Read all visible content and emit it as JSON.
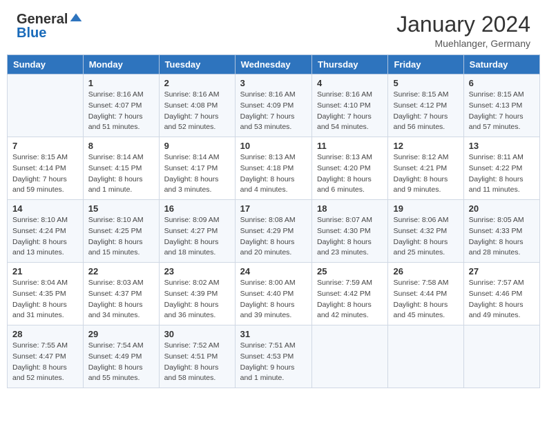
{
  "header": {
    "logo_general": "General",
    "logo_blue": "Blue",
    "month": "January 2024",
    "location": "Muehlanger, Germany"
  },
  "weekdays": [
    "Sunday",
    "Monday",
    "Tuesday",
    "Wednesday",
    "Thursday",
    "Friday",
    "Saturday"
  ],
  "weeks": [
    [
      {
        "day": "",
        "sunrise": "",
        "sunset": "",
        "daylight": ""
      },
      {
        "day": "1",
        "sunrise": "Sunrise: 8:16 AM",
        "sunset": "Sunset: 4:07 PM",
        "daylight": "Daylight: 7 hours and 51 minutes."
      },
      {
        "day": "2",
        "sunrise": "Sunrise: 8:16 AM",
        "sunset": "Sunset: 4:08 PM",
        "daylight": "Daylight: 7 hours and 52 minutes."
      },
      {
        "day": "3",
        "sunrise": "Sunrise: 8:16 AM",
        "sunset": "Sunset: 4:09 PM",
        "daylight": "Daylight: 7 hours and 53 minutes."
      },
      {
        "day": "4",
        "sunrise": "Sunrise: 8:16 AM",
        "sunset": "Sunset: 4:10 PM",
        "daylight": "Daylight: 7 hours and 54 minutes."
      },
      {
        "day": "5",
        "sunrise": "Sunrise: 8:15 AM",
        "sunset": "Sunset: 4:12 PM",
        "daylight": "Daylight: 7 hours and 56 minutes."
      },
      {
        "day": "6",
        "sunrise": "Sunrise: 8:15 AM",
        "sunset": "Sunset: 4:13 PM",
        "daylight": "Daylight: 7 hours and 57 minutes."
      }
    ],
    [
      {
        "day": "7",
        "sunrise": "Sunrise: 8:15 AM",
        "sunset": "Sunset: 4:14 PM",
        "daylight": "Daylight: 7 hours and 59 minutes."
      },
      {
        "day": "8",
        "sunrise": "Sunrise: 8:14 AM",
        "sunset": "Sunset: 4:15 PM",
        "daylight": "Daylight: 8 hours and 1 minute."
      },
      {
        "day": "9",
        "sunrise": "Sunrise: 8:14 AM",
        "sunset": "Sunset: 4:17 PM",
        "daylight": "Daylight: 8 hours and 3 minutes."
      },
      {
        "day": "10",
        "sunrise": "Sunrise: 8:13 AM",
        "sunset": "Sunset: 4:18 PM",
        "daylight": "Daylight: 8 hours and 4 minutes."
      },
      {
        "day": "11",
        "sunrise": "Sunrise: 8:13 AM",
        "sunset": "Sunset: 4:20 PM",
        "daylight": "Daylight: 8 hours and 6 minutes."
      },
      {
        "day": "12",
        "sunrise": "Sunrise: 8:12 AM",
        "sunset": "Sunset: 4:21 PM",
        "daylight": "Daylight: 8 hours and 9 minutes."
      },
      {
        "day": "13",
        "sunrise": "Sunrise: 8:11 AM",
        "sunset": "Sunset: 4:22 PM",
        "daylight": "Daylight: 8 hours and 11 minutes."
      }
    ],
    [
      {
        "day": "14",
        "sunrise": "Sunrise: 8:10 AM",
        "sunset": "Sunset: 4:24 PM",
        "daylight": "Daylight: 8 hours and 13 minutes."
      },
      {
        "day": "15",
        "sunrise": "Sunrise: 8:10 AM",
        "sunset": "Sunset: 4:25 PM",
        "daylight": "Daylight: 8 hours and 15 minutes."
      },
      {
        "day": "16",
        "sunrise": "Sunrise: 8:09 AM",
        "sunset": "Sunset: 4:27 PM",
        "daylight": "Daylight: 8 hours and 18 minutes."
      },
      {
        "day": "17",
        "sunrise": "Sunrise: 8:08 AM",
        "sunset": "Sunset: 4:29 PM",
        "daylight": "Daylight: 8 hours and 20 minutes."
      },
      {
        "day": "18",
        "sunrise": "Sunrise: 8:07 AM",
        "sunset": "Sunset: 4:30 PM",
        "daylight": "Daylight: 8 hours and 23 minutes."
      },
      {
        "day": "19",
        "sunrise": "Sunrise: 8:06 AM",
        "sunset": "Sunset: 4:32 PM",
        "daylight": "Daylight: 8 hours and 25 minutes."
      },
      {
        "day": "20",
        "sunrise": "Sunrise: 8:05 AM",
        "sunset": "Sunset: 4:33 PM",
        "daylight": "Daylight: 8 hours and 28 minutes."
      }
    ],
    [
      {
        "day": "21",
        "sunrise": "Sunrise: 8:04 AM",
        "sunset": "Sunset: 4:35 PM",
        "daylight": "Daylight: 8 hours and 31 minutes."
      },
      {
        "day": "22",
        "sunrise": "Sunrise: 8:03 AM",
        "sunset": "Sunset: 4:37 PM",
        "daylight": "Daylight: 8 hours and 34 minutes."
      },
      {
        "day": "23",
        "sunrise": "Sunrise: 8:02 AM",
        "sunset": "Sunset: 4:39 PM",
        "daylight": "Daylight: 8 hours and 36 minutes."
      },
      {
        "day": "24",
        "sunrise": "Sunrise: 8:00 AM",
        "sunset": "Sunset: 4:40 PM",
        "daylight": "Daylight: 8 hours and 39 minutes."
      },
      {
        "day": "25",
        "sunrise": "Sunrise: 7:59 AM",
        "sunset": "Sunset: 4:42 PM",
        "daylight": "Daylight: 8 hours and 42 minutes."
      },
      {
        "day": "26",
        "sunrise": "Sunrise: 7:58 AM",
        "sunset": "Sunset: 4:44 PM",
        "daylight": "Daylight: 8 hours and 45 minutes."
      },
      {
        "day": "27",
        "sunrise": "Sunrise: 7:57 AM",
        "sunset": "Sunset: 4:46 PM",
        "daylight": "Daylight: 8 hours and 49 minutes."
      }
    ],
    [
      {
        "day": "28",
        "sunrise": "Sunrise: 7:55 AM",
        "sunset": "Sunset: 4:47 PM",
        "daylight": "Daylight: 8 hours and 52 minutes."
      },
      {
        "day": "29",
        "sunrise": "Sunrise: 7:54 AM",
        "sunset": "Sunset: 4:49 PM",
        "daylight": "Daylight: 8 hours and 55 minutes."
      },
      {
        "day": "30",
        "sunrise": "Sunrise: 7:52 AM",
        "sunset": "Sunset: 4:51 PM",
        "daylight": "Daylight: 8 hours and 58 minutes."
      },
      {
        "day": "31",
        "sunrise": "Sunrise: 7:51 AM",
        "sunset": "Sunset: 4:53 PM",
        "daylight": "Daylight: 9 hours and 1 minute."
      },
      {
        "day": "",
        "sunrise": "",
        "sunset": "",
        "daylight": ""
      },
      {
        "day": "",
        "sunrise": "",
        "sunset": "",
        "daylight": ""
      },
      {
        "day": "",
        "sunrise": "",
        "sunset": "",
        "daylight": ""
      }
    ]
  ]
}
